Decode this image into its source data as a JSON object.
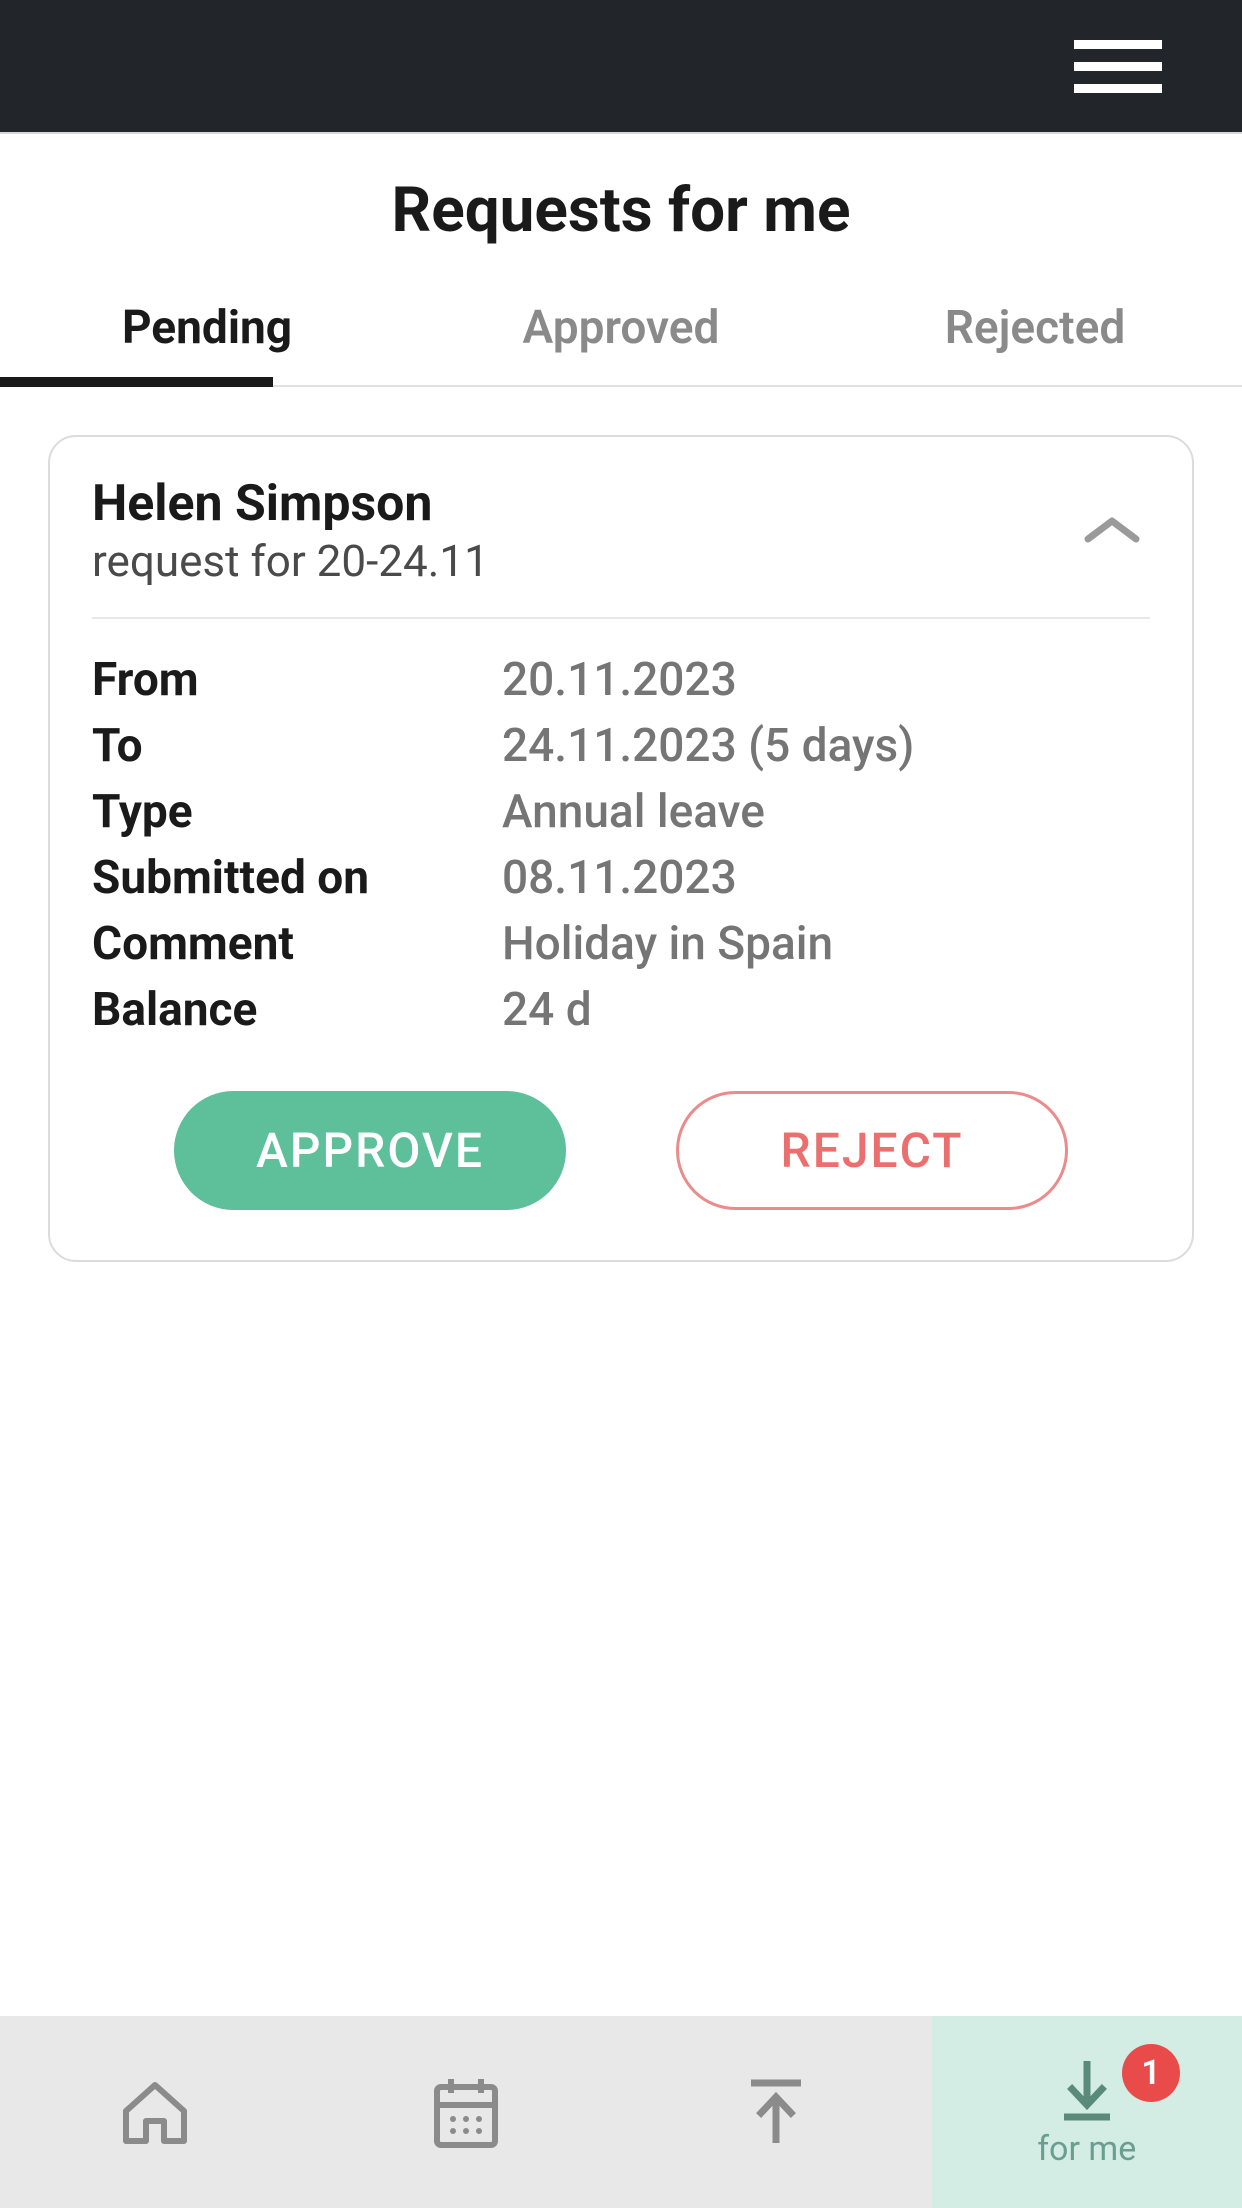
{
  "header": {
    "title": "Requests for me"
  },
  "tabs": {
    "pending": "Pending",
    "approved": "Approved",
    "rejected": "Rejected"
  },
  "request": {
    "name": "Helen Simpson",
    "subtitle": "request for 20-24.11",
    "labels": {
      "from": "From",
      "to": "To",
      "type": "Type",
      "submitted": "Submitted on",
      "comment": "Comment",
      "balance": "Balance"
    },
    "values": {
      "from": "20.11.2023",
      "to": "24.11.2023 (5 days)",
      "type": "Annual leave",
      "submitted": "08.11.2023",
      "comment": "Holiday in Spain",
      "balance": "24 d"
    },
    "actions": {
      "approve": "APPROVE",
      "reject": "REJECT"
    }
  },
  "bottomNav": {
    "forMeLabel": "for me",
    "badgeCount": "1"
  }
}
